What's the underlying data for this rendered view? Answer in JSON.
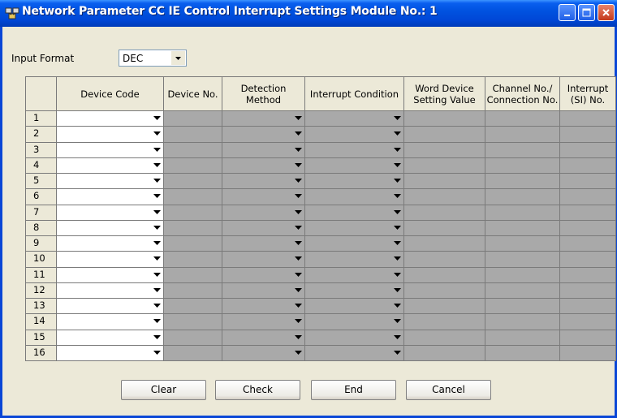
{
  "window": {
    "title": "Network Parameter  CC IE Control Interrupt Settings Module No.: 1"
  },
  "input_format": {
    "label": "Input Format",
    "value": "DEC"
  },
  "table": {
    "columns": [
      "Device Code",
      "Device No.",
      "Detection\nMethod",
      "Interrupt Condition",
      "Word Device\nSetting Value",
      "Channel No./\nConnection No.",
      "Interrupt\n(SI) No."
    ],
    "rows": [
      "1",
      "2",
      "3",
      "4",
      "5",
      "6",
      "7",
      "8",
      "9",
      "10",
      "11",
      "12",
      "13",
      "14",
      "15",
      "16"
    ]
  },
  "buttons": {
    "clear": "Clear",
    "check": "Check",
    "end": "End",
    "cancel": "Cancel"
  },
  "colors": {
    "title_bar": "#0052E0",
    "dialog_bg": "#ECE9D8",
    "disabled_cell": "#A9A9A9"
  }
}
